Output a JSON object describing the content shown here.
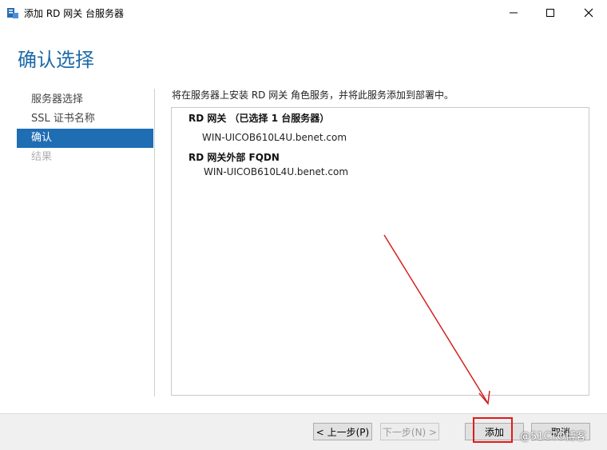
{
  "window": {
    "title": "添加 RD 网关 台服务器",
    "controls": [
      "minimize",
      "maximize",
      "close"
    ]
  },
  "page": {
    "title": "确认选择",
    "description": "将在服务器上安装 RD 网关 角色服务，并将此服务添加到部署中。"
  },
  "nav": {
    "items": [
      {
        "label": "服务器选择",
        "state": "normal"
      },
      {
        "label": "SSL 证书名称",
        "state": "normal"
      },
      {
        "label": "确认",
        "state": "active"
      },
      {
        "label": "结果",
        "state": "disabled"
      }
    ]
  },
  "summary": {
    "gateway_heading": "RD 网关 （已选择 1 台服务器）",
    "gateway_server": "WIN-UICOB610L4U.benet.com",
    "fqdn_heading": "RD 网关外部 FQDN",
    "fqdn_value": "WIN-UICOB610L4U.benet.com"
  },
  "footer": {
    "prev_label": "< 上一步(P)",
    "next_label": "下一步(N) >",
    "add_label": "添加",
    "cancel_label": "取消"
  },
  "watermark": "@51CTO博客",
  "colors": {
    "accent": "#1f6db3",
    "title": "#1e6aa8",
    "annotation": "#e01b1b"
  }
}
